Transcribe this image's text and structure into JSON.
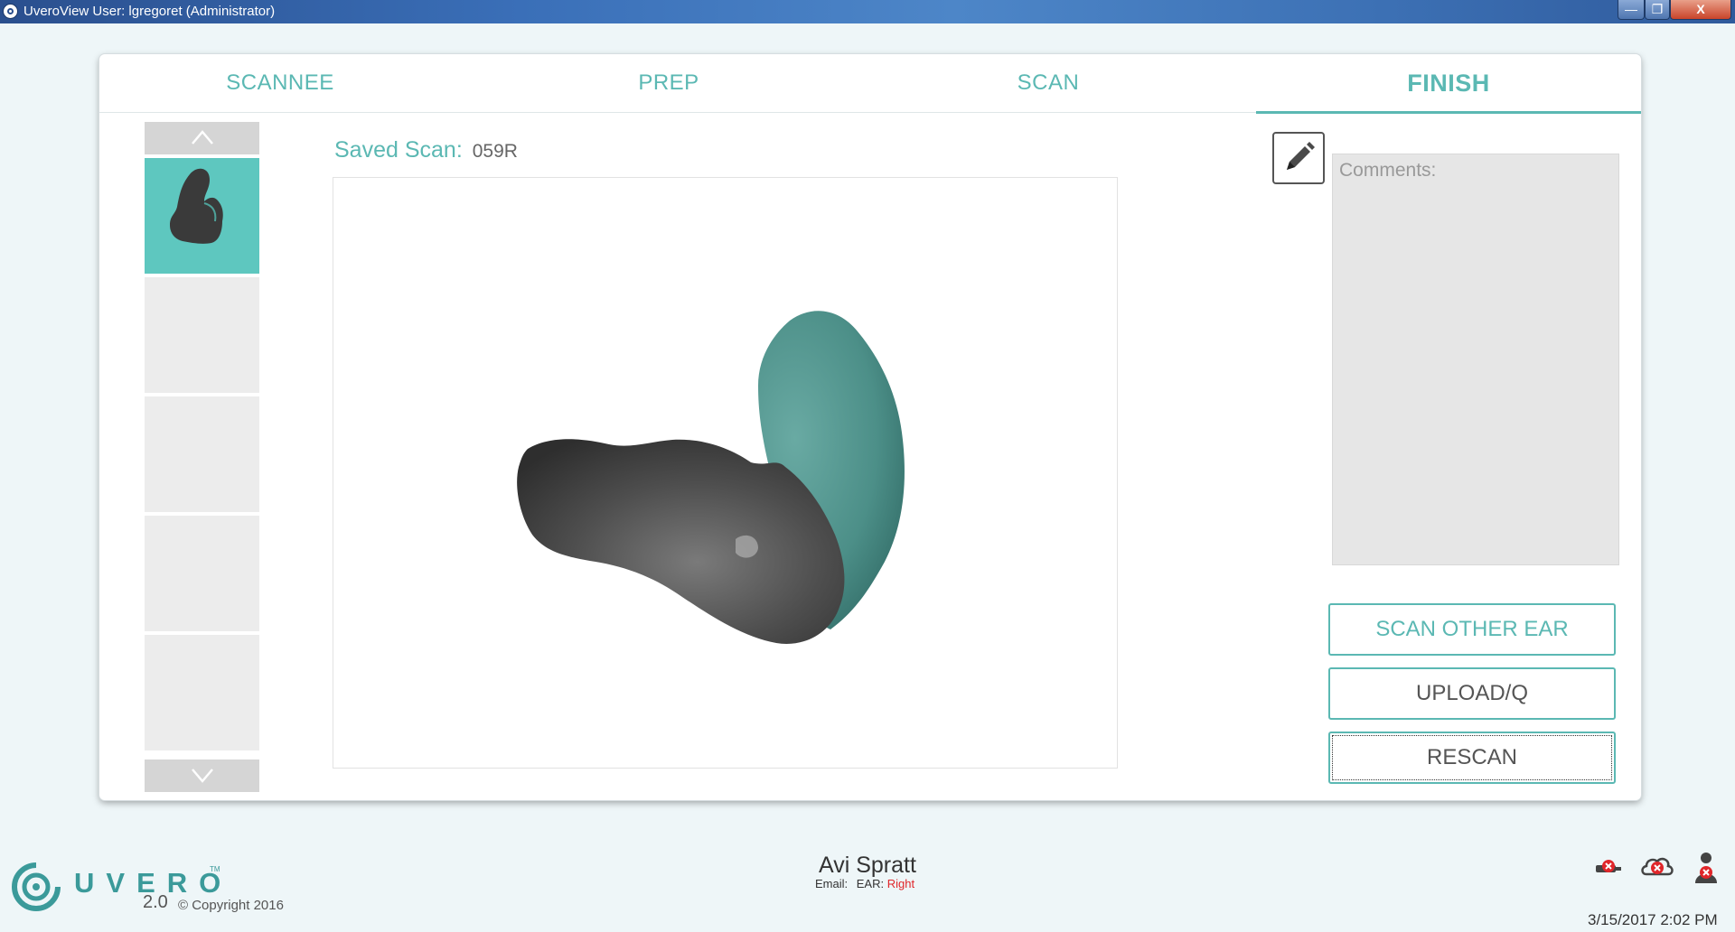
{
  "window": {
    "title": "UveroView User: lgregoret (Administrator)",
    "min_label": "—",
    "max_label": "❐",
    "close_label": "X"
  },
  "tabs": [
    {
      "label": "SCANNEE"
    },
    {
      "label": "PREP"
    },
    {
      "label": "SCAN"
    },
    {
      "label": "FINISH",
      "active": true
    }
  ],
  "scan": {
    "saved_label": "Saved Scan:",
    "saved_value": "059R"
  },
  "comments": {
    "label": "Comments:"
  },
  "actions": {
    "scan_other_ear": "SCAN OTHER EAR",
    "upload": "UPLOAD/Q",
    "rescan": "RESCAN"
  },
  "footer": {
    "logo_text": "UVERO",
    "logo_tm": "TM",
    "version": "2.0",
    "copyright": "© Copyright 2016",
    "patient_name": "Avi Spratt",
    "email_label": "Email:",
    "ear_label": "EAR:",
    "ear_value": "Right",
    "datetime": "3/15/2017 2:02 PM"
  },
  "colors": {
    "accent": "#5bb8b3",
    "ear_red": "#e0262a",
    "scan_teal": "#4e958e",
    "scan_gray": "#4a4a4a"
  },
  "icons": {
    "edit": "pencil-icon",
    "status": [
      "scanner-disconnected-icon",
      "cloud-disconnected-icon",
      "user-disconnected-icon"
    ]
  }
}
